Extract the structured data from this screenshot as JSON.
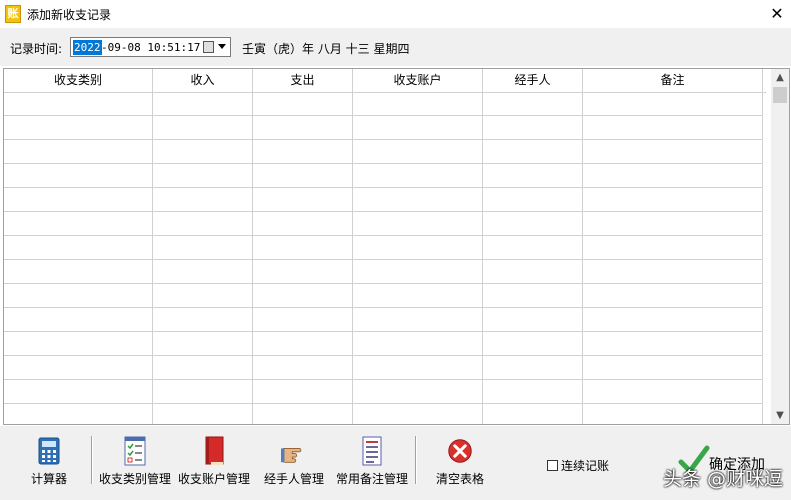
{
  "window": {
    "title": "添加新收支记录",
    "close_glyph": "✕",
    "app_icon_glyph": "账"
  },
  "timebar": {
    "label": "记录时间:",
    "date_year": "2022",
    "date_rest": "-09-08 10:51:17",
    "lunar_text": "壬寅（虎）年 八月 十三 星期四"
  },
  "grid": {
    "columns": [
      "收支类别",
      "收入",
      "支出",
      "收支账户",
      "经手人",
      "备注"
    ],
    "row_count": 14
  },
  "toolbar": {
    "calculator": "计算器",
    "category_mgmt": "收支类别管理",
    "account_mgmt": "收支账户管理",
    "handler_mgmt": "经手人管理",
    "remark_mgmt": "常用备注管理",
    "clear_table": "清空表格",
    "continuous": "连续记账",
    "confirm": "确定添加"
  },
  "watermark": "头条 @财咪逗",
  "colors": {
    "selection": "#0078d7",
    "clear_red": "#d9302c",
    "confirm_green": "#3aa64a"
  }
}
